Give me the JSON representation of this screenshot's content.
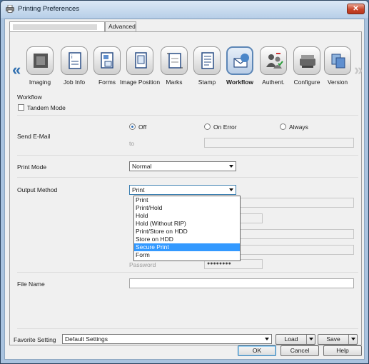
{
  "window": {
    "title": "Printing Preferences",
    "close_symbol": "✕"
  },
  "tabs": [
    {
      "label": ""
    },
    {
      "label": "Advanced"
    }
  ],
  "icon_strip": {
    "items": [
      {
        "label": "Imaging",
        "icon": "imaging-icon"
      },
      {
        "label": "Job Info",
        "icon": "job-info-icon"
      },
      {
        "label": "Forms",
        "icon": "forms-icon"
      },
      {
        "label": "Image Position",
        "icon": "image-position-icon"
      },
      {
        "label": "Marks",
        "icon": "marks-icon"
      },
      {
        "label": "Stamp",
        "icon": "stamp-icon"
      },
      {
        "label": "Workflow",
        "icon": "workflow-icon",
        "selected": true
      },
      {
        "label": "Authent.",
        "icon": "authentication-icon"
      },
      {
        "label": "Configure",
        "icon": "configure-icon"
      },
      {
        "label": "Version",
        "icon": "version-icon"
      }
    ]
  },
  "workflow": {
    "section_title": "Workflow",
    "tandem_mode": {
      "label": "Tandem Mode",
      "checked": false
    },
    "send_email": {
      "label": "Send E-Mail",
      "options": [
        "Off",
        "On Error",
        "Always"
      ],
      "selected": "Off",
      "to_label": "to",
      "to_value": ""
    },
    "print_mode": {
      "label": "Print Mode",
      "value": "Normal"
    },
    "output_method": {
      "label": "Output Method",
      "value": "Print",
      "options": [
        "Print",
        "Print/Hold",
        "Hold",
        "Hold (Without RIP)",
        "Print/Store on HDD",
        "Store on HDD",
        "Secure Print",
        "Form"
      ],
      "highlighted": "Secure Print"
    },
    "password": {
      "label": "Password",
      "value": "●●●●●●●●"
    },
    "file_name": {
      "label": "File Name",
      "value": ""
    }
  },
  "footer": {
    "favorite_label": "Favorite Setting",
    "favorite_value": "Default Settings",
    "load_label": "Load",
    "save_label": "Save",
    "ok_label": "OK",
    "cancel_label": "Cancel",
    "help_label": "Help"
  },
  "colors": {
    "accent": "#3399ff",
    "titlebar": "#b8cfe8",
    "close": "#c9452a"
  }
}
